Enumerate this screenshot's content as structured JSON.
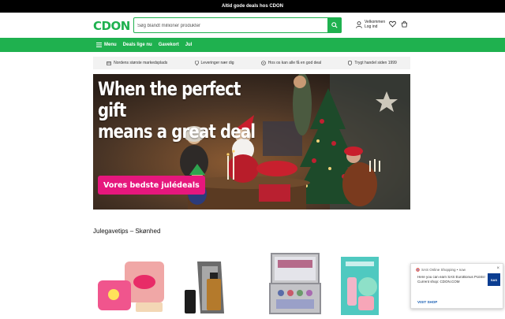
{
  "topbar": {
    "text": "Altid gode deals hos CDON"
  },
  "header": {
    "logo": "CDON",
    "search_placeholder": "Søg blandt millioner produkter",
    "account_line1": "Velkommen",
    "account_line2": "Log ind"
  },
  "nav": {
    "items": [
      "Menu",
      "Deals lige nu",
      "Gavekort",
      "Jul"
    ]
  },
  "usps": [
    "Nordens største markedsplads",
    "Leveringer nær dig",
    "Hos os kan alle få en god deal",
    "Trygt handel siden 1999"
  ],
  "hero": {
    "title_line1": "When the perfect gift",
    "title_line2": "means a great deal",
    "cta": "Vores bedste julédeals"
  },
  "section": {
    "title": "Julegavetips – Skønhed"
  },
  "toast": {
    "source": "SAS Online Shopping • now",
    "body_line1": "Here you can earn SAS EuroBonus Points!",
    "body_line2": "Current shop: CDON.COM",
    "link": "VISIT SHOP",
    "logo": "SAS",
    "close": "×"
  },
  "colors": {
    "brand_green": "#1fb14f",
    "cta_pink": "#e6177d"
  }
}
